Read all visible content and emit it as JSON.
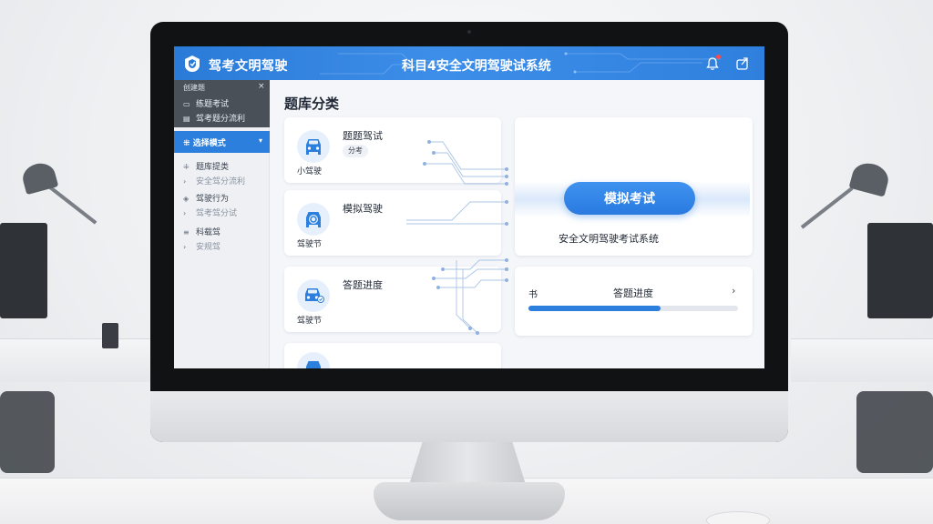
{
  "header": {
    "brand": "驾考文明驾驶",
    "title": "科目4安全文明驾驶试系统"
  },
  "sidebar": {
    "head_title": "创建题",
    "close_glyph": "×",
    "head_items": [
      {
        "label": "练题考试",
        "icon": "doc-icon"
      },
      {
        "label": "驾考题分流利",
        "icon": "card-icon"
      }
    ],
    "active_item": {
      "label": "选择模式",
      "icon": "grid-icon"
    },
    "items": [
      {
        "label": "题库提类",
        "icon": "grid-icon",
        "sub": false
      },
      {
        "label": "安全驾分流利",
        "icon": "arrow-icon",
        "sub": true
      },
      {
        "label": "驾驶行为",
        "icon": "tag-icon",
        "sub": false
      },
      {
        "label": "驾考驾分试",
        "icon": "arrow-icon",
        "sub": true
      },
      {
        "label": "科载驾",
        "icon": "list-icon",
        "sub": false
      },
      {
        "label": "安规驾",
        "icon": "arrow-icon",
        "sub": true
      }
    ]
  },
  "main": {
    "section_title": "题库分类",
    "categories": [
      {
        "name": "题题驾试",
        "sub": "小驾驶",
        "pill": "分考",
        "icon": "car-front-icon"
      },
      {
        "name": "模拟驾驶",
        "sub": "驾驶节",
        "icon": "car-steer-icon"
      },
      {
        "name": "答题进度",
        "sub": "驾驶节",
        "icon": "car-check-icon"
      }
    ],
    "exam": {
      "button": "模拟考试",
      "caption": "安全文明驾驶考试系统"
    },
    "progress": {
      "left_label": "书",
      "label": "答题进度",
      "arrow": "›",
      "value": 0.63
    }
  },
  "colors": {
    "accent": "#2d7fde",
    "topbar": "#2f80de",
    "notify": "#ff4a4a"
  }
}
